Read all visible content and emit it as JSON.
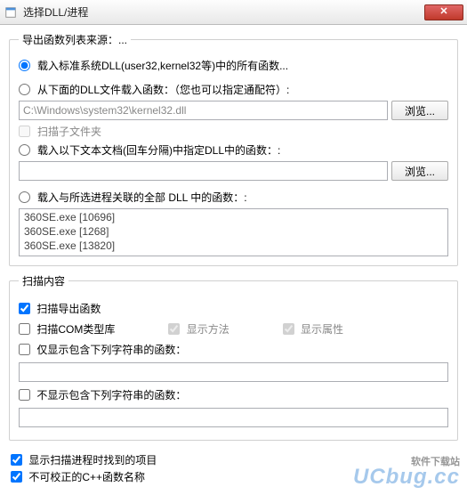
{
  "window": {
    "title": "选择DLL/进程"
  },
  "group_source": {
    "legend": "导出函数列表来源：...",
    "opt_system": "载入标准系统DLL(user32,kernel32等)中的所有函数...",
    "opt_file": "从下面的DLL文件载入函数：（您也可以指定通配符）:",
    "file_path": "C:\\Windows\\system32\\kernel32.dll",
    "browse1": "浏览...",
    "scan_sub": "扫描子文件夹",
    "opt_text": "载入以下文本文档(回车分隔)中指定DLL中的函数：:",
    "text_path": "",
    "browse2": "浏览...",
    "opt_proc": "载入与所选进程关联的全部 DLL 中的函数：:",
    "proc_items": [
      "360SE.exe  [10696]",
      "360SE.exe  [1268]",
      "360SE.exe  [13820]"
    ]
  },
  "group_scan": {
    "legend": "扫描内容",
    "scan_export": "扫描导出函数",
    "scan_com": "扫描COM类型库",
    "show_methods": "显示方法",
    "show_props": "显示属性",
    "only_show": "仅显示包含下列字符串的函数：",
    "only_show_value": "",
    "dont_show": "不显示包含下列字符串的函数：",
    "dont_show_value": ""
  },
  "bottom": {
    "show_scan_items": "显示扫描进程时找到的项目",
    "uncorrectable": "不可校正的C++函数名称"
  },
  "watermark": {
    "sub": "软件下载站",
    "main": "UCbug.cc"
  }
}
